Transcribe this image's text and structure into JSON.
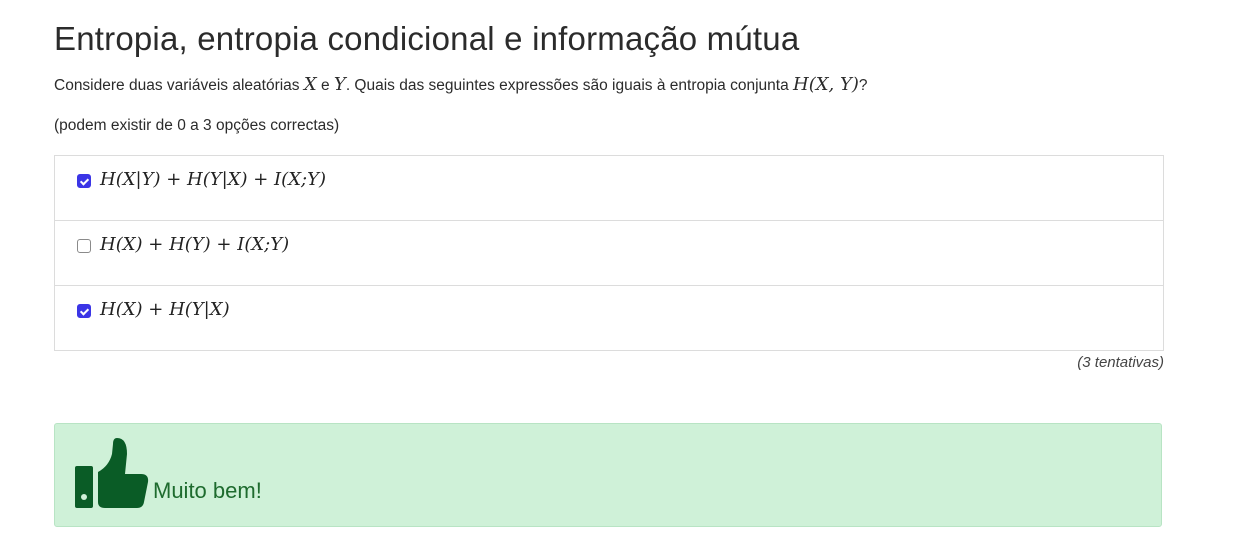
{
  "page": {
    "title": "Entropia, entropia condicional e informação mútua",
    "question": {
      "prefix": "Considere duas variáveis aleatórias ",
      "var_x": "X",
      "conj": " e ",
      "var_y": "Y",
      "middle": ". Quais das seguintes expressões são iguais à entropia conjunta ",
      "expr": "H(X, Y)",
      "suffix": "?"
    },
    "hint": "(podem existir de 0 a 3 opções correctas)",
    "options": [
      {
        "label": "H(X|Y) + H(Y|X) + I(X;Y)",
        "checked": true
      },
      {
        "label": "H(X) + H(Y) + I(X;Y)",
        "checked": false
      },
      {
        "label": "H(X) + H(Y|X)",
        "checked": true
      }
    ],
    "attempts": "(3 tentativas)",
    "feedback": {
      "icon": "thumbs-up-icon",
      "text": "Muito bem!",
      "color": "#1e6b2e",
      "background": "#cff1d8"
    },
    "accent_color": "#3b35e6"
  }
}
